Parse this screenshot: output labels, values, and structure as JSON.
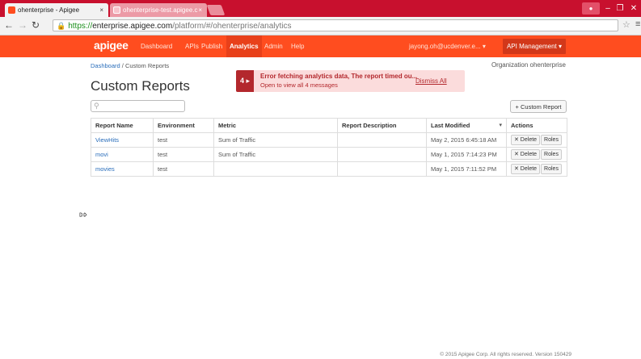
{
  "browser": {
    "tabs": [
      {
        "title": "ohenterprise - Apigee",
        "active": true
      },
      {
        "title": "ohenterprise-test.apigee.c",
        "active": false
      }
    ],
    "close_glyph": "×",
    "address": {
      "scheme": "https://",
      "host": "enterprise.apigee.com",
      "path": "/platform/#/ohenterprise/analytics"
    },
    "nav_icons": [
      "back-arrow-icon",
      "forward-arrow-icon",
      "reload-icon",
      "lock-icon",
      "star-icon",
      "menu-icon"
    ]
  },
  "navbar": {
    "logo": "apigee",
    "items": [
      "Dashboard",
      "APIs",
      "Publish",
      "Analytics",
      "Admin",
      "Help"
    ],
    "active_item": "Analytics",
    "user": "jayong.oh@ucdenver.e...",
    "user_caret": "▾",
    "product_menu": "API Management",
    "brand_color": "#ff4d1f"
  },
  "page": {
    "breadcrumb": {
      "root": "Dashboard",
      "separator": " / ",
      "current": "Custom Reports"
    },
    "org": "Organization ohenterprise",
    "title": "Custom Reports",
    "search_placeholder": "",
    "add_button": "+ Custom Report"
  },
  "alert": {
    "count": "4 ▸",
    "message": "Error fetching analytics data, The report timed ou...",
    "sub": "Open to view all 4 messages",
    "dismiss": "Dismiss All",
    "color": "#b3282d"
  },
  "table": {
    "headers": [
      "Report Name",
      "Environment",
      "Metric",
      "Report Description",
      "Last Modified",
      "Actions"
    ],
    "sort_caret": "▾",
    "rows": [
      {
        "name": "ViewHits",
        "env": "test",
        "metric": "Sum of Traffic",
        "desc": "",
        "modified": "May 2, 2015 6:45:18 AM"
      },
      {
        "name": "movi",
        "env": "test",
        "metric": "Sum of Traffic",
        "desc": "",
        "modified": "May 1, 2015 7:14:23 PM"
      },
      {
        "name": "movies",
        "env": "test",
        "metric": "",
        "desc": "",
        "modified": "May 1, 2015 7:11:52 PM"
      }
    ],
    "delete_label": "✕ Delete",
    "roles_label": "Roles"
  },
  "footer": "© 2015 Apigee Corp. All rights reserved. Version 150429"
}
